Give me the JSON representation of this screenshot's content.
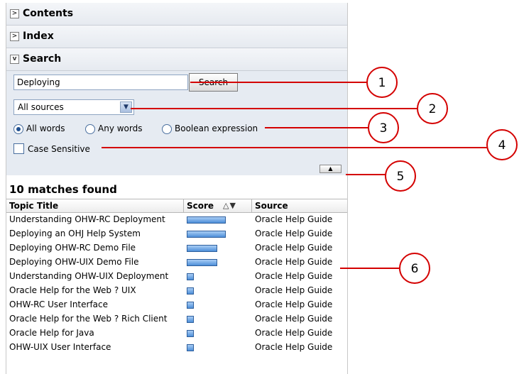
{
  "accordion": {
    "contents_label": "Contents",
    "index_label": "Index",
    "search_label": "Search"
  },
  "search": {
    "query": "Deploying",
    "button_label": "Search",
    "source_selected": "All sources",
    "radio_all_words": "All words",
    "radio_any_words": "Any words",
    "radio_boolean": "Boolean expression",
    "case_sensitive_label": "Case Sensitive",
    "selected_mode": "All words",
    "case_sensitive": false
  },
  "results": {
    "summary": "10 matches found",
    "columns": {
      "topic": "Topic Title",
      "score": "Score",
      "source": "Source"
    },
    "rows": [
      {
        "topic": "Understanding OHW-RC Deployment",
        "score": 1.0,
        "source": "Oracle Help Guide"
      },
      {
        "topic": "Deploying an OHJ Help System",
        "score": 1.0,
        "source": "Oracle Help Guide"
      },
      {
        "topic": "Deploying OHW-RC Demo File",
        "score": 0.78,
        "source": "Oracle Help Guide"
      },
      {
        "topic": "Deploying OHW-UIX Demo File",
        "score": 0.78,
        "source": "Oracle Help Guide"
      },
      {
        "topic": "Understanding OHW-UIX Deployment",
        "score": 0.2,
        "source": "Oracle Help Guide"
      },
      {
        "topic": "Oracle Help for the Web ? UIX",
        "score": 0.2,
        "source": "Oracle Help Guide"
      },
      {
        "topic": "OHW-RC User Interface",
        "score": 0.2,
        "source": "Oracle Help Guide"
      },
      {
        "topic": "Oracle Help for the Web ? Rich Client",
        "score": 0.2,
        "source": "Oracle Help Guide"
      },
      {
        "topic": "Oracle Help for Java",
        "score": 0.2,
        "source": "Oracle Help Guide"
      },
      {
        "topic": "OHW-UIX User Interface",
        "score": 0.2,
        "source": "Oracle Help Guide"
      }
    ]
  },
  "callouts": [
    "1",
    "2",
    "3",
    "4",
    "5",
    "6"
  ],
  "colors": {
    "callout": "#d40000",
    "bar": "#4d8fd9",
    "panel_bg": "#e6ebf2"
  },
  "icons": {
    "collapse": "collapse-up-icon",
    "sort": "sort-asc-desc-icon",
    "dropdown": "chevron-down-icon"
  }
}
